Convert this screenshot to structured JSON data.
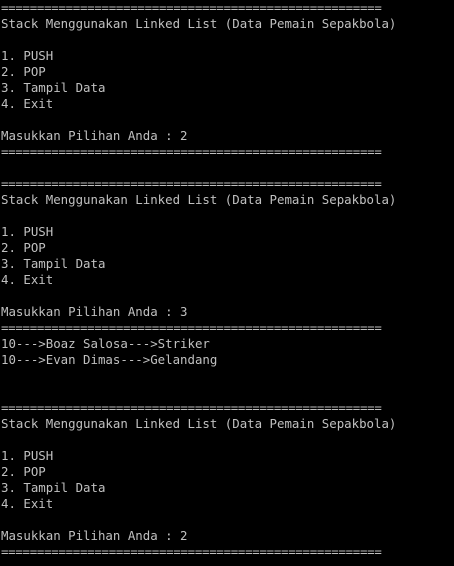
{
  "console": {
    "colors": {
      "background": "#000000",
      "text": "#c0c0c0"
    },
    "lines": [
      "=====================================================",
      "Stack Menggunakan Linked List (Data Pemain Sepakbola)",
      "",
      "1. PUSH",
      "2. POP",
      "3. Tampil Data",
      "4. Exit",
      "",
      "Masukkan Pilihan Anda : 2",
      "=====================================================",
      "",
      "=====================================================",
      "Stack Menggunakan Linked List (Data Pemain Sepakbola)",
      "",
      "1. PUSH",
      "2. POP",
      "3. Tampil Data",
      "4. Exit",
      "",
      "Masukkan Pilihan Anda : 3",
      "=====================================================",
      "10--->Boaz Salosa--->Striker",
      "10--->Evan Dimas--->Gelandang",
      "",
      "",
      "=====================================================",
      "Stack Menggunakan Linked List (Data Pemain Sepakbola)",
      "",
      "1. PUSH",
      "2. POP",
      "3. Tampil Data",
      "4. Exit",
      "",
      "Masukkan Pilihan Anda : 2",
      "====================================================="
    ]
  }
}
